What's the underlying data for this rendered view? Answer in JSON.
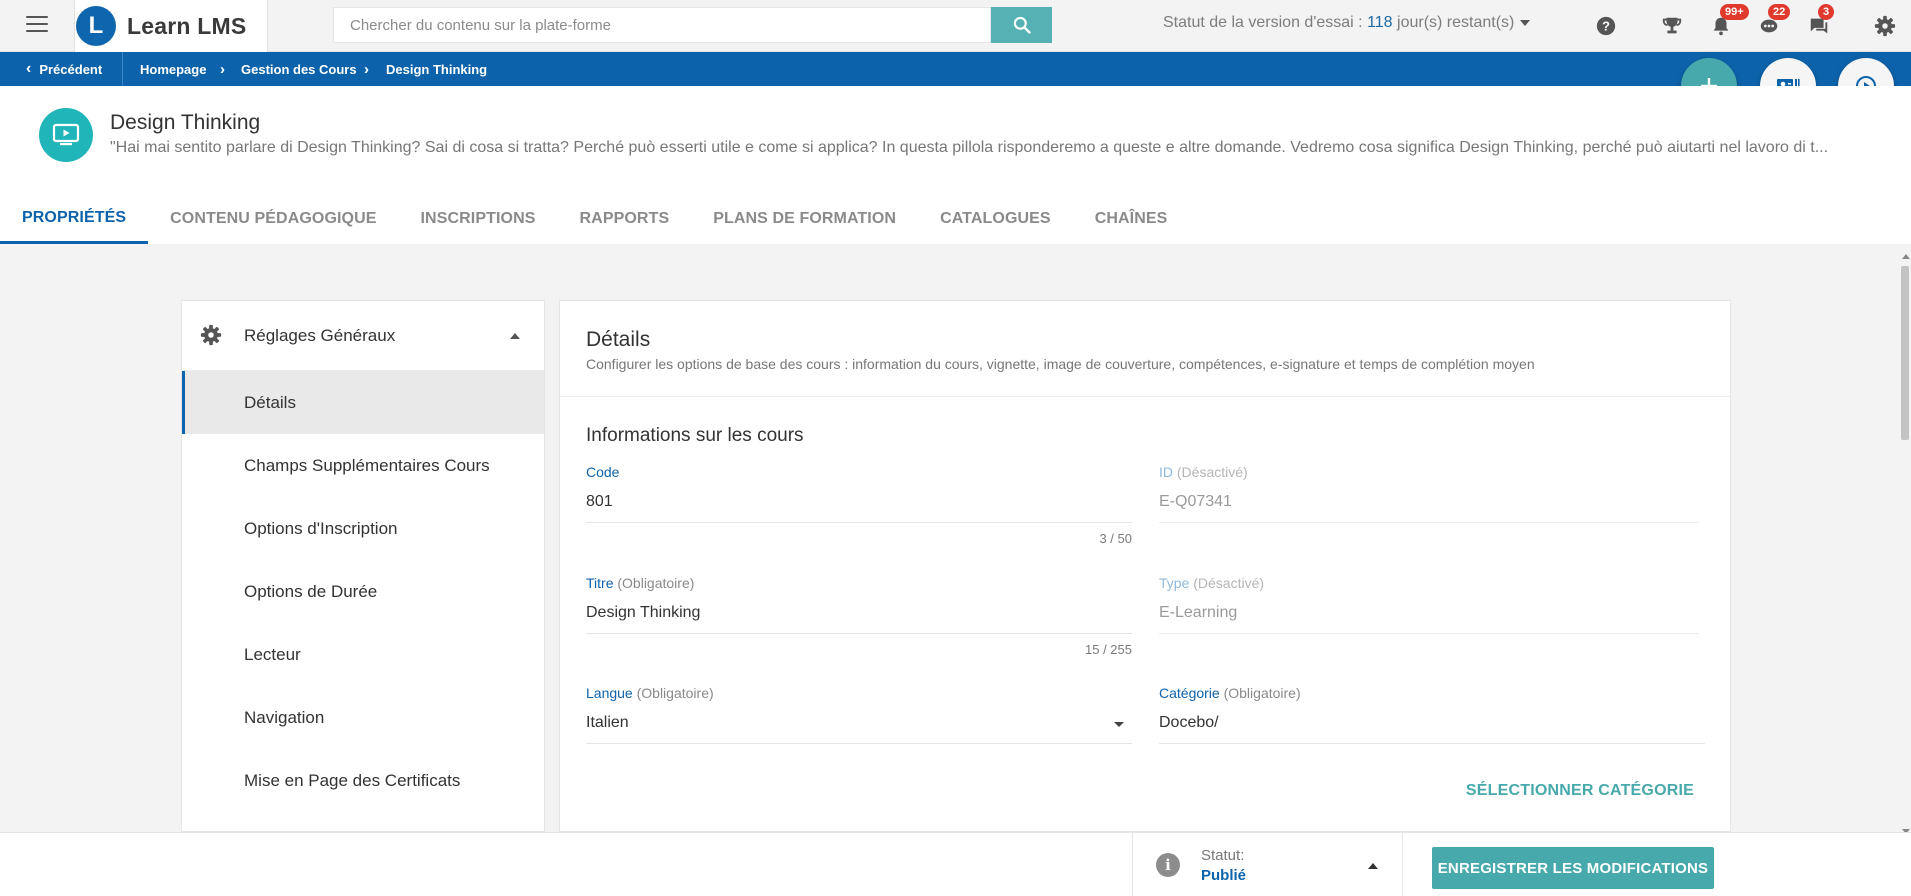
{
  "topbar": {
    "brand_name": "Learn LMS",
    "brand_logo_letter": "L",
    "search_placeholder": "Chercher du contenu sur la plate-forme",
    "trial_prefix": "Statut de la version d'essai : ",
    "trial_days": "118",
    "trial_suffix": " jour(s) restant(s)",
    "badges": {
      "notifications": "99+",
      "messages": "22",
      "chat": "3"
    }
  },
  "breadcrumb": {
    "back": "Précédent",
    "items": [
      "Homepage",
      "Gestion des Cours",
      "Design Thinking"
    ]
  },
  "course": {
    "title": "Design Thinking",
    "description": "\"Hai mai sentito parlare di Design Thinking? Sai di cosa si tratta? Perché può esserti utile e come si applica? In questa pillola risponderemo a queste e altre domande. Vedremo cosa significa Design Thinking, perché può aiutarti nel lavoro di t..."
  },
  "tabs": [
    "PROPRIÉTÉS",
    "CONTENU PÉDAGOGIQUE",
    "INSCRIPTIONS",
    "RAPPORTS",
    "PLANS DE FORMATION",
    "CATALOGUES",
    "CHAÎNES"
  ],
  "sidebar": {
    "header": "Réglages Généraux",
    "items": [
      "Détails",
      "Champs Supplémentaires Cours",
      "Options d'Inscription",
      "Options de Durée",
      "Lecteur",
      "Navigation",
      "Mise en Page des Certificats"
    ]
  },
  "details": {
    "title": "Détails",
    "subtitle": "Configurer les options de base des cours : information du cours, vignette, image de couverture, compétences, e-signature et temps de complétion moyen",
    "section_title": "Informations sur les cours",
    "fields": {
      "code": {
        "label": "Code",
        "value": "801",
        "counter": "3 / 50"
      },
      "id": {
        "label": "ID",
        "note": "(Désactivé)",
        "value": "E-Q07341"
      },
      "titre": {
        "label": "Titre",
        "note": "(Obligatoire)",
        "value": "Design Thinking",
        "counter": "15 / 255"
      },
      "type": {
        "label": "Type",
        "note": "(Désactivé)",
        "value": "E-Learning"
      },
      "langue": {
        "label": "Langue",
        "note": "(Obligatoire)",
        "value": "Italien"
      },
      "categorie": {
        "label": "Catégorie",
        "note": "(Obligatoire)",
        "value": "Docebo/"
      }
    },
    "select_category": "SÉLECTIONNER CATÉGORIE"
  },
  "footer": {
    "status_label": "Statut:",
    "status_value": "Publié",
    "save_label": "ENREGISTRER LES MODIFICATIONS"
  },
  "icons": {
    "menu": "menu-icon",
    "search": "search-icon",
    "help": "help-icon",
    "trophy": "trophy-icon",
    "bell": "bell-icon",
    "messages": "messages-icon",
    "chat": "chat-icon",
    "settings": "gear-icon",
    "add": "plus-icon",
    "course_card": "course-card-icon",
    "play": "play-icon",
    "course": "course-screen-icon",
    "info": "info-icon"
  },
  "colors": {
    "primary": "#0d63ab",
    "accent": "#47a9ab",
    "badge": "#e03a2f",
    "course_icon": "#20b5b9"
  }
}
